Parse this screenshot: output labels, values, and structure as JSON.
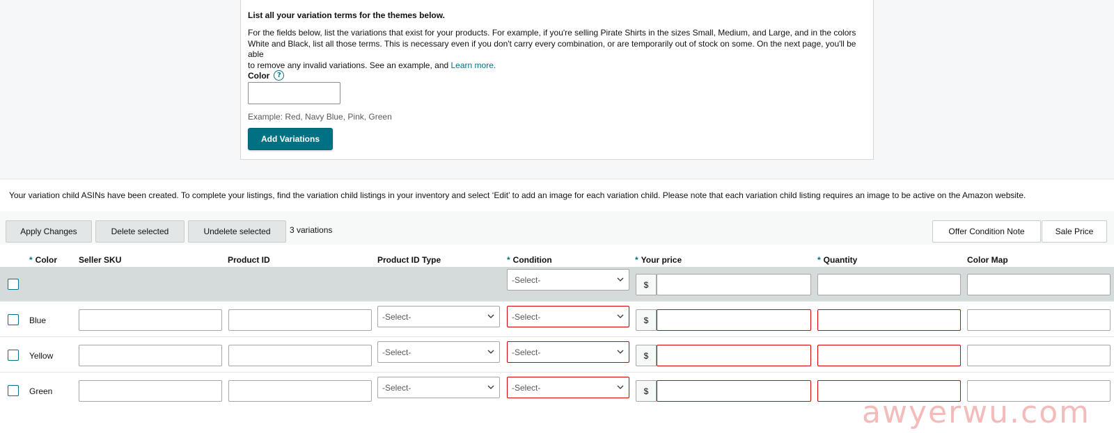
{
  "card": {
    "title": "List all your variation terms for the themes below.",
    "description_line1": "For the fields below, list the variations that exist for your products. For example, if you're selling Pirate Shirts in the sizes Small, Medium, and Large, and in the colors",
    "description_line2": "White and Black, list all those terms. This is necessary even if you don't carry every combination, or are temporarily out of stock on some. On the next page, you'll be able",
    "description_line3": "to remove any invalid variations. See an example, and ",
    "learn_more": "Learn more.",
    "color_label": "Color",
    "help_icon": "?",
    "color_input_value": "",
    "example": "Example: Red, Navy Blue, Pink, Green",
    "add_button": "Add Variations"
  },
  "notice": "Your variation child ASINs have been created. To complete your listings, find the variation child listings in your inventory and select ‘Edit’ to add an image for each variation child. Please note that each variation child listing requires an image to be active on the Amazon website.",
  "toolbar": {
    "apply": "Apply Changes",
    "delete": "Delete selected",
    "undelete": "Undelete selected",
    "count": "3 variations",
    "offer_note": "Offer Condition Note",
    "sale_price": "Sale Price"
  },
  "table": {
    "required_mark": "*",
    "headers": {
      "color": "Color",
      "sku": "Seller SKU",
      "product_id": "Product ID",
      "product_id_type": "Product ID Type",
      "condition": "Condition",
      "price": "Your price",
      "quantity": "Quantity",
      "color_map": "Color Map"
    },
    "select_placeholder": "-Select-",
    "currency": "$",
    "rows": [
      {
        "color": "Blue"
      },
      {
        "color": "Yellow"
      },
      {
        "color": "Green"
      }
    ]
  },
  "watermark": "awyerwu.com",
  "colors": {
    "accent": "#007185",
    "error": "#d00000",
    "bulk_row": "#d5dbdb"
  }
}
